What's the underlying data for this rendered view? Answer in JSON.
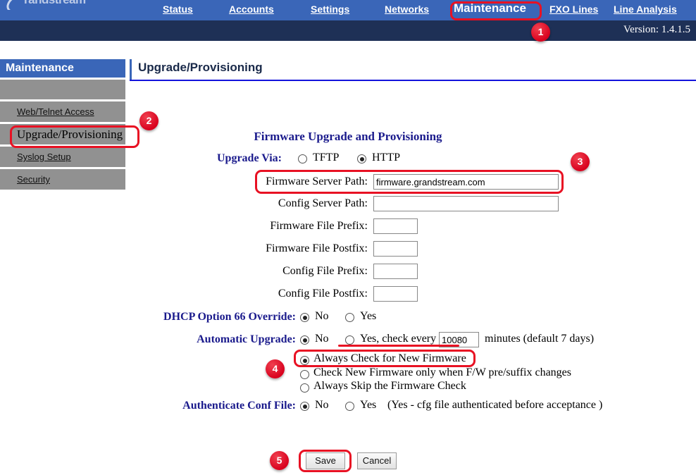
{
  "brand": {
    "logo_text": "randstream",
    "logo_icon": "grandstream-swoosh-icon"
  },
  "topnav": {
    "items": [
      {
        "label": "Status",
        "id": "status"
      },
      {
        "label": "Accounts",
        "id": "accounts"
      },
      {
        "label": "Settings ",
        "id": "settings"
      },
      {
        "label": "Networks",
        "id": "networks"
      },
      {
        "label": "Maintenance",
        "id": "maintenance",
        "active": true
      },
      {
        "label": "FXO Lines",
        "id": "fxo-lines"
      },
      {
        "label": "Line Analysis",
        "id": "line-analysis"
      }
    ],
    "version_text": "Version: 1.4.1.5",
    "bar_color": "#3a66b8",
    "version_bar_color": "#1e3056"
  },
  "sidebar": {
    "title": "Maintenance",
    "items": [
      {
        "label": "",
        "id": "blank",
        "blank": true
      },
      {
        "label": "Web/Telnet Access",
        "id": "web-telnet-access"
      },
      {
        "label": "Upgrade/Provisioning",
        "id": "upgrade-provisioning",
        "active": true
      },
      {
        "label": "Syslog Setup",
        "id": "syslog-setup"
      },
      {
        "label": "Security",
        "id": "security"
      }
    ],
    "item_bg": "#919191"
  },
  "main": {
    "page_title": "Upgrade/Provisioning",
    "form_heading": "Firmware Upgrade and Provisioning",
    "labels": {
      "upgrade_via": "Upgrade Via:",
      "firmware_server_path": "Firmware Server Path:",
      "config_server_path": "Config Server Path:",
      "firmware_file_prefix": "Firmware File Prefix:",
      "firmware_file_postfix": "Firmware File Postfix:",
      "config_file_prefix": "Config File Prefix:",
      "config_file_postfix": "Config File Postfix:",
      "dhcp_option_66": "DHCP Option 66 Override:",
      "automatic_upgrade": "Automatic Upgrade:",
      "authenticate_conf_file": "Authenticate Conf File:"
    },
    "upgrade_via": {
      "options": [
        {
          "label": "TFTP",
          "selected": false
        },
        {
          "label": "HTTP",
          "selected": true
        }
      ]
    },
    "fields": {
      "firmware_server_path": {
        "value": "firmware.grandstream.com",
        "placeholder": ""
      },
      "config_server_path": {
        "value": "",
        "placeholder": ""
      },
      "firmware_file_prefix": {
        "value": "",
        "placeholder": ""
      },
      "firmware_file_postfix": {
        "value": "",
        "placeholder": ""
      },
      "config_file_prefix": {
        "value": "",
        "placeholder": ""
      },
      "config_file_postfix": {
        "value": "",
        "placeholder": ""
      },
      "check_interval_minutes": {
        "value": "10080",
        "placeholder": ""
      }
    },
    "dhcp_option_66": {
      "options": [
        {
          "label": "No",
          "selected": true
        },
        {
          "label": "Yes",
          "selected": false
        }
      ]
    },
    "automatic_upgrade": {
      "options": [
        {
          "label": "No",
          "selected": true
        },
        {
          "label": "Yes, check every",
          "selected": false
        }
      ],
      "suffix_text": "minutes (default 7 days)"
    },
    "firmware_check": {
      "options": [
        {
          "label": "Always Check for New Firmware",
          "selected": true
        },
        {
          "label": "Check New Firmware only when F/W pre/suffix changes",
          "selected": false
        },
        {
          "label": "Always Skip the Firmware Check",
          "selected": false
        }
      ]
    },
    "authenticate_conf_file": {
      "options": [
        {
          "label": "No",
          "selected": true
        },
        {
          "label": "Yes",
          "selected": false
        }
      ],
      "note": "(Yes - cfg file authenticated before acceptance )"
    },
    "buttons": {
      "save": "Save",
      "cancel": "Cancel"
    }
  },
  "annotations": {
    "color": "#e81123",
    "badges": [
      {
        "number": "1",
        "target": "maintenance-tab"
      },
      {
        "number": "2",
        "target": "sidebar-upgrade-provisioning"
      },
      {
        "number": "3",
        "target": "firmware-server-path-field"
      },
      {
        "number": "4",
        "target": "always-check-for-new-firmware-radio"
      },
      {
        "number": "5",
        "target": "save-button"
      }
    ]
  }
}
